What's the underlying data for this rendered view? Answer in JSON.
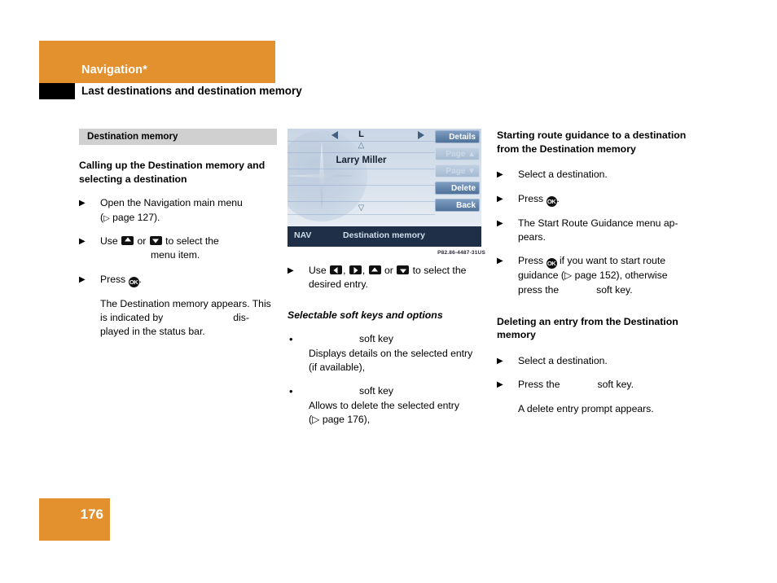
{
  "header": {
    "chapter": "Navigation*",
    "section": "Last destinations and destination memory"
  },
  "left_column": {
    "grey_bar": "Destination memory",
    "heading": "Calling up the Destination memory and selecting a destination",
    "steps": [
      {
        "marker": "▶",
        "text_before": "Open the Navigation main menu (",
        "ref_symbol": "▷",
        "ref_text": " page 127).",
        "text_after": ""
      },
      {
        "marker": "▶",
        "text": "Use",
        "mid": "or",
        "tail": "to select the",
        "second_line": "menu item."
      },
      {
        "marker": "▶",
        "text": "Press",
        "tail": "."
      }
    ],
    "body_text_line1": "The Destination memory appears. This",
    "body_text_line2a": "is indicated by",
    "body_text_line2b": "dis-",
    "body_text_line3": "played in the status bar."
  },
  "nav_screen": {
    "letter": "L",
    "left_arrow_icon": "triangle-left-icon",
    "right_arrow_icon": "triangle-right-icon",
    "scroll_up_glyph": "△",
    "scroll_down_glyph": "▽",
    "entry": "Larry Miller",
    "softkeys": [
      {
        "label": "Details",
        "enabled": true
      },
      {
        "label": "Page ▲",
        "enabled": false
      },
      {
        "label": "Page ▼",
        "enabled": false
      },
      {
        "label": "Delete",
        "enabled": true
      },
      {
        "label": "Back",
        "enabled": true
      }
    ],
    "status_tag": "NAV",
    "status_title": "Destination memory",
    "figure_id": "P82.86-4487-31US"
  },
  "mid_column": {
    "use_step": {
      "marker": "▶",
      "lead": "Use",
      "sep1": ",",
      "sep2": ",",
      "or_word": "or",
      "tail": "to select the",
      "second_line": "desired entry."
    },
    "subheading": "Selectable soft keys and options",
    "options": [
      {
        "marker": "•",
        "key_label": "",
        "suffix": "soft key",
        "desc_line1": "Displays details on the selected entry",
        "desc_line2": "(if available),"
      },
      {
        "marker": "•",
        "key_label": "",
        "suffix": "soft key",
        "desc_line1": "Allows to delete the selected entry",
        "desc_line2_pre": "(",
        "ref_symbol": "▷",
        "desc_line2_post": " page 176),"
      }
    ]
  },
  "right_column": {
    "heading1": "Starting route guidance to a destination from the Destination memory",
    "steps1": [
      {
        "marker": "▶",
        "text": "Select a destination."
      },
      {
        "marker": "▶",
        "text": "Press",
        "tail": "."
      },
      {
        "marker": "▶",
        "text": "The Start Route Guidance menu ap-pears."
      },
      {
        "marker": "▶",
        "line1a": "Press",
        "line1b": "if you want to start route",
        "line2a": "guidance (",
        "ref_symbol": "▷",
        "line2b": " page 152), otherwise",
        "line3a": "press the",
        "line3b": "soft key."
      }
    ],
    "heading2": "Deleting an entry from the Destination memory",
    "steps2": [
      {
        "marker": "▶",
        "text": "Select a destination."
      },
      {
        "marker": "▶",
        "line_a": "Press the",
        "line_b": "soft key."
      }
    ],
    "note": "A delete entry prompt appears."
  },
  "footer": {
    "page_number": "176"
  },
  "colors": {
    "accent_orange": "#e3912f",
    "grey_bar": "#d0d0d0",
    "nav_status_bar": "#1f2f47"
  }
}
